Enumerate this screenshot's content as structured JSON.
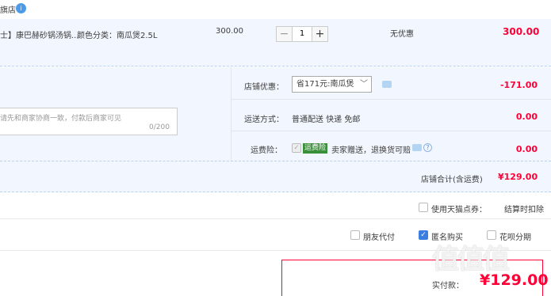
{
  "shop": {
    "name": "旗店",
    "badge": "i"
  },
  "item": {
    "title": "士】康巴赫砂锅汤锅...",
    "spec": "颜色分类：南瓜煲2.5L",
    "price": "300.00",
    "quantity": "1",
    "minus": "−",
    "plus": "+",
    "promo": "无优惠",
    "subtotal": "300.00"
  },
  "shop_discount": {
    "label": "店铺优惠：",
    "selected": "省171元:南瓜煲",
    "amount": "-171.00"
  },
  "memo": {
    "placeholder": "请先和商家协商一致，付款后商家可见",
    "count": "0/200"
  },
  "shipping": {
    "label": "运送方式：",
    "value": "普通配送 快递 免邮",
    "amount": "0.00"
  },
  "insurance": {
    "label": "运费险：",
    "tag": "运费险",
    "text": "卖家赠送，退换货可赔",
    "amount": "0.00"
  },
  "shop_total": {
    "label": "店铺合计(含运费)",
    "amount": "¥129.00"
  },
  "tmall_points": {
    "label": "使用天猫点券：",
    "note": "结算时扣除"
  },
  "pay_options": {
    "friend": "朋友代付",
    "anon": "匿名购买",
    "other": "花呗分期"
  },
  "final": {
    "label": "实付款：",
    "amount": "¥129.00"
  },
  "watermark": "值值值",
  "colors": {
    "price_red": "#ff0036",
    "accent_blue": "#3a7ee0",
    "row_bg": "#f2f7ff"
  }
}
